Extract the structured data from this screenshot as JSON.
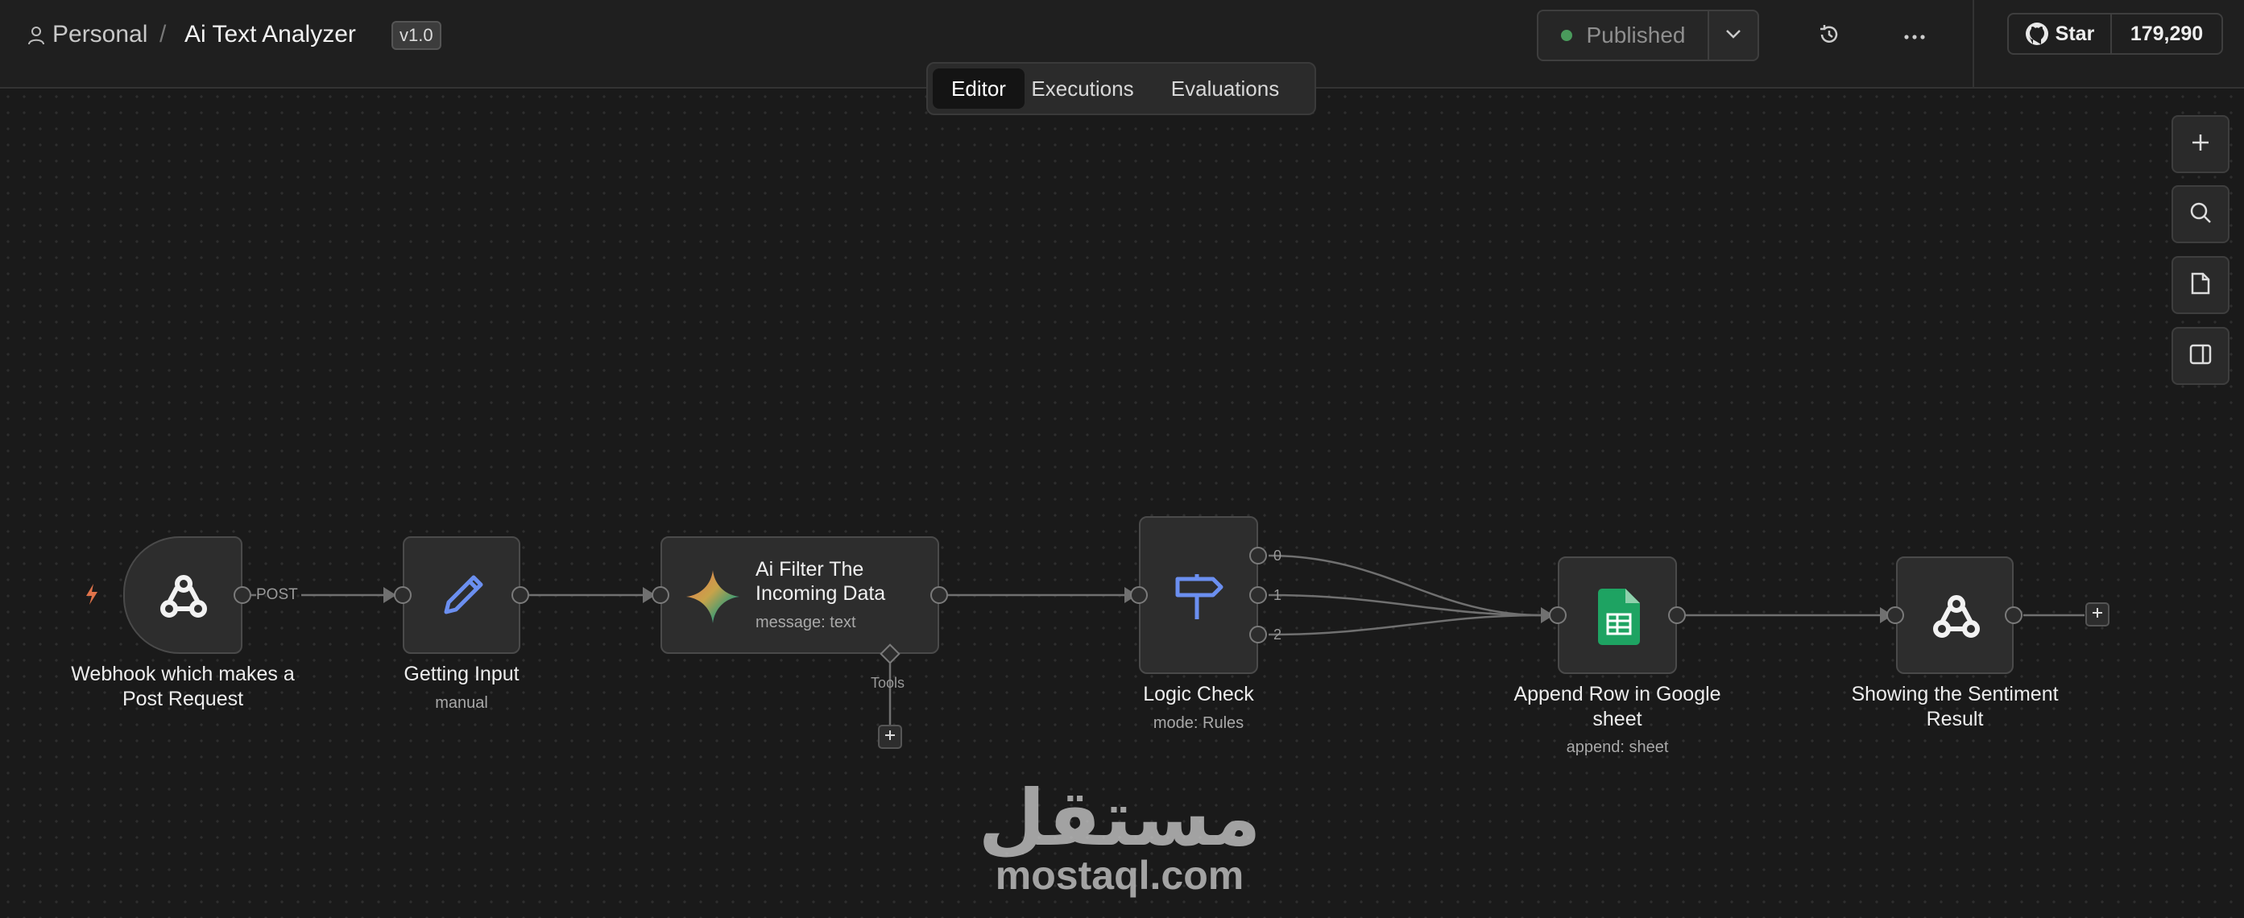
{
  "header": {
    "breadcrumb": {
      "project": "Personal",
      "separator": "/",
      "workflow": "Ai Text Analyzer"
    },
    "version_badge": "v1.0",
    "publish_status": "Published",
    "github": {
      "star_label": "Star",
      "star_count": "179,290"
    }
  },
  "tabs": [
    {
      "label": "Editor",
      "active": true
    },
    {
      "label": "Executions",
      "active": false
    },
    {
      "label": "Evaluations",
      "active": false
    }
  ],
  "nodes": {
    "webhook": {
      "title": "Webhook which makes a Post Request",
      "output_label": "POST",
      "icon": "webhook-icon"
    },
    "getting_input": {
      "title": "Getting Input",
      "subtitle": "manual",
      "icon": "pencil-icon"
    },
    "ai_filter": {
      "title": "Ai Filter The Incoming Data",
      "subtitle": "message: text",
      "tools_label": "Tools",
      "icon": "gemini-sparkle-icon"
    },
    "logic_check": {
      "title": "Logic Check",
      "subtitle": "mode: Rules",
      "outputs": [
        "0",
        "1",
        "2"
      ],
      "icon": "signpost-icon"
    },
    "append_row": {
      "title": "Append Row in Google sheet",
      "subtitle": "append: sheet",
      "icon": "google-sheets-icon"
    },
    "sentiment": {
      "title": "Showing the Sentiment Result",
      "icon": "webhook-icon"
    }
  },
  "watermark": {
    "arabic": "مستقل",
    "latin": "mostaql.com"
  },
  "colors": {
    "background": "#1a1a1a",
    "node": "#2d2d2d",
    "published_dot": "#4a9b5c",
    "trigger_bolt": "#e0734a",
    "sheets_green": "#1ea362",
    "pencil_blue": "#6b8ff0"
  }
}
